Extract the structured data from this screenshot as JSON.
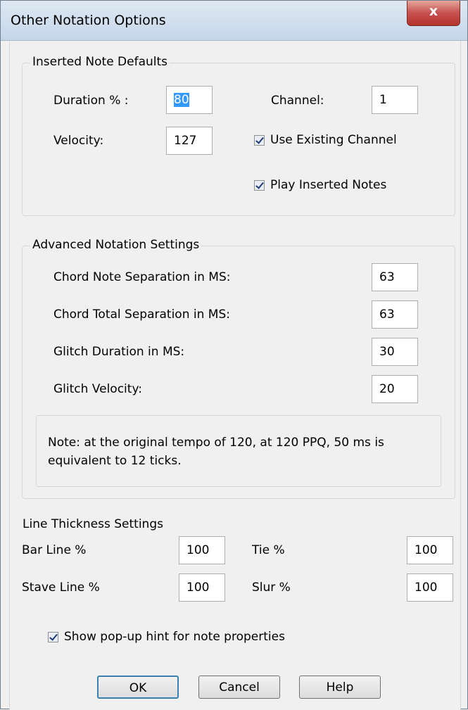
{
  "window": {
    "title": "Other Notation Options",
    "close_glyph": "x"
  },
  "inserted": {
    "title": "Inserted Note Defaults",
    "duration_label": "Duration % :",
    "duration_value": "80",
    "velocity_label": "Velocity:",
    "velocity_value": "127",
    "channel_label": "Channel:",
    "channel_value": "1",
    "use_existing_label": "Use Existing Channel",
    "use_existing_checked": true,
    "play_inserted_label": "Play Inserted Notes",
    "play_inserted_checked": true
  },
  "advanced": {
    "title": "Advanced Notation Settings",
    "rows": [
      {
        "label": "Chord Note Separation in MS:",
        "value": "63"
      },
      {
        "label": "Chord Total Separation in MS:",
        "value": "63"
      },
      {
        "label": "Glitch Duration in MS:",
        "value": "30"
      },
      {
        "label": "Glitch Velocity:",
        "value": "20"
      }
    ],
    "note": "Note: at the original tempo of 120, at 120 PPQ, 50 ms is equivalent to 12 ticks."
  },
  "line": {
    "title": "Line Thickness Settings",
    "bar_label": "Bar Line %",
    "bar_value": "100",
    "stave_label": "Stave Line %",
    "stave_value": "100",
    "tie_label": "Tie %",
    "tie_value": "100",
    "slur_label": "Slur %",
    "slur_value": "100"
  },
  "popup_hint": {
    "label": "Show pop-up hint for note properties",
    "checked": true
  },
  "buttons": {
    "ok": "OK",
    "cancel": "Cancel",
    "help": "Help"
  }
}
